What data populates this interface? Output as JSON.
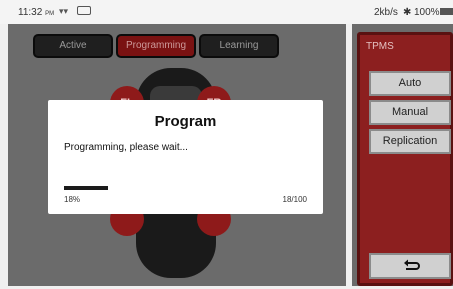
{
  "status_bar": {
    "time": "11:32",
    "ampm": "PM",
    "net_speed": "2kb/s",
    "battery": "100%",
    "icons": [
      "wifi-icon",
      "usb-icon",
      "bluetooth-icon",
      "battery-icon"
    ]
  },
  "tabs": [
    {
      "label": "Active",
      "selected": false
    },
    {
      "label": "Programming",
      "selected": true
    },
    {
      "label": "Learning",
      "selected": false
    }
  ],
  "wheels": {
    "fl": "FL",
    "fr": "FR"
  },
  "sidebar": {
    "title": "TPMS",
    "buttons": [
      "Auto",
      "Manual",
      "Replication"
    ],
    "back_icon": "back-arrow-icon"
  },
  "dialog": {
    "title": "Program",
    "message": "Programming, please wait...",
    "progress_fraction": 0.18,
    "percent_label": "18%",
    "count_label": "18/100"
  },
  "colors": {
    "accent_red": "#8c1f1f",
    "tab_dark": "#1f1f1f",
    "progress": "#1b1b1b"
  }
}
